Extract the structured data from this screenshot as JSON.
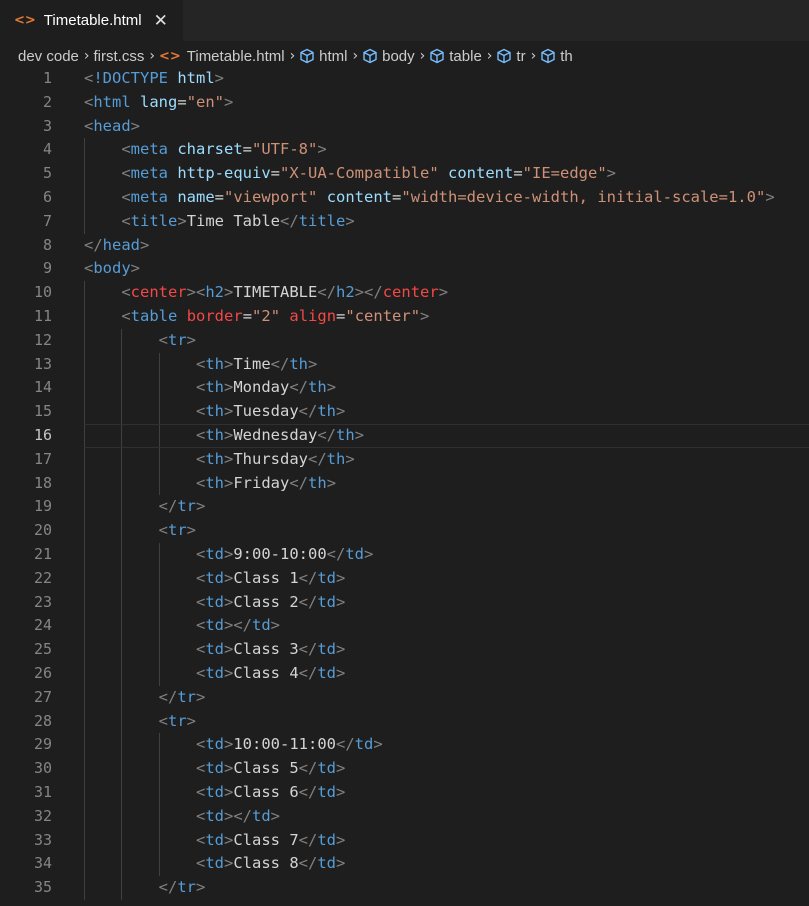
{
  "tab": {
    "label": "Timetable.html",
    "close_glyph": "✕",
    "icon": "html-file-icon"
  },
  "breadcrumb": [
    {
      "label": "dev code",
      "icon": ""
    },
    {
      "label": "first.css",
      "icon": ""
    },
    {
      "label": "Timetable.html",
      "icon": "html-file-icon"
    },
    {
      "label": "html",
      "icon": "cube-icon"
    },
    {
      "label": "body",
      "icon": "cube-icon"
    },
    {
      "label": "table",
      "icon": "cube-icon"
    },
    {
      "label": "tr",
      "icon": "cube-icon"
    },
    {
      "label": "th",
      "icon": "cube-icon"
    }
  ],
  "active_line": 16,
  "colors": {
    "tag": "#569cd6",
    "attr": "#9cdcfe",
    "string": "#ce9178",
    "text": "#d4d4d4",
    "deprecated": "#f44747",
    "punct": "#808080"
  },
  "lines": [
    [
      [
        "p",
        "<"
      ],
      [
        "t",
        "!DOCTYPE"
      ],
      [
        "x",
        " "
      ],
      [
        "a",
        "html"
      ],
      [
        "p",
        ">"
      ]
    ],
    [
      [
        "p",
        "<"
      ],
      [
        "t",
        "html"
      ],
      [
        "x",
        " "
      ],
      [
        "a",
        "lang"
      ],
      [
        "x",
        "="
      ],
      [
        "s",
        "\"en\""
      ],
      [
        "p",
        ">"
      ]
    ],
    [
      [
        "p",
        "<"
      ],
      [
        "t",
        "head"
      ],
      [
        "p",
        ">"
      ]
    ],
    [
      [
        "x",
        "    "
      ],
      [
        "p",
        "<"
      ],
      [
        "t",
        "meta"
      ],
      [
        "x",
        " "
      ],
      [
        "a",
        "charset"
      ],
      [
        "x",
        "="
      ],
      [
        "s",
        "\"UTF-8\""
      ],
      [
        "p",
        ">"
      ]
    ],
    [
      [
        "x",
        "    "
      ],
      [
        "p",
        "<"
      ],
      [
        "t",
        "meta"
      ],
      [
        "x",
        " "
      ],
      [
        "a",
        "http-equiv"
      ],
      [
        "x",
        "="
      ],
      [
        "s",
        "\"X-UA-Compatible\""
      ],
      [
        "x",
        " "
      ],
      [
        "a",
        "content"
      ],
      [
        "x",
        "="
      ],
      [
        "s",
        "\"IE=edge\""
      ],
      [
        "p",
        ">"
      ]
    ],
    [
      [
        "x",
        "    "
      ],
      [
        "p",
        "<"
      ],
      [
        "t",
        "meta"
      ],
      [
        "x",
        " "
      ],
      [
        "a",
        "name"
      ],
      [
        "x",
        "="
      ],
      [
        "s",
        "\"viewport\""
      ],
      [
        "x",
        " "
      ],
      [
        "a",
        "content"
      ],
      [
        "x",
        "="
      ],
      [
        "s",
        "\"width=device-width, initial-scale=1.0\""
      ],
      [
        "p",
        ">"
      ]
    ],
    [
      [
        "x",
        "    "
      ],
      [
        "p",
        "<"
      ],
      [
        "t",
        "title"
      ],
      [
        "p",
        ">"
      ],
      [
        "x",
        "Time Table"
      ],
      [
        "p",
        "</"
      ],
      [
        "t",
        "title"
      ],
      [
        "p",
        ">"
      ]
    ],
    [
      [
        "p",
        "</"
      ],
      [
        "t",
        "head"
      ],
      [
        "p",
        ">"
      ]
    ],
    [
      [
        "p",
        "<"
      ],
      [
        "t",
        "body"
      ],
      [
        "p",
        ">"
      ]
    ],
    [
      [
        "x",
        "    "
      ],
      [
        "p",
        "<"
      ],
      [
        "r",
        "center"
      ],
      [
        "p",
        "><"
      ],
      [
        "t",
        "h2"
      ],
      [
        "p",
        ">"
      ],
      [
        "x",
        "TIMETABLE"
      ],
      [
        "p",
        "</"
      ],
      [
        "t",
        "h2"
      ],
      [
        "p",
        "></"
      ],
      [
        "r",
        "center"
      ],
      [
        "p",
        ">"
      ]
    ],
    [
      [
        "x",
        "    "
      ],
      [
        "p",
        "<"
      ],
      [
        "t",
        "table"
      ],
      [
        "x",
        " "
      ],
      [
        "r",
        "border"
      ],
      [
        "x",
        "="
      ],
      [
        "s",
        "\"2\""
      ],
      [
        "x",
        " "
      ],
      [
        "r",
        "align"
      ],
      [
        "x",
        "="
      ],
      [
        "s",
        "\"center\""
      ],
      [
        "p",
        ">"
      ]
    ],
    [
      [
        "x",
        "        "
      ],
      [
        "p",
        "<"
      ],
      [
        "t",
        "tr"
      ],
      [
        "p",
        ">"
      ]
    ],
    [
      [
        "x",
        "            "
      ],
      [
        "p",
        "<"
      ],
      [
        "t",
        "th"
      ],
      [
        "p",
        ">"
      ],
      [
        "x",
        "Time"
      ],
      [
        "p",
        "</"
      ],
      [
        "t",
        "th"
      ],
      [
        "p",
        ">"
      ]
    ],
    [
      [
        "x",
        "            "
      ],
      [
        "p",
        "<"
      ],
      [
        "t",
        "th"
      ],
      [
        "p",
        ">"
      ],
      [
        "x",
        "Monday"
      ],
      [
        "p",
        "</"
      ],
      [
        "t",
        "th"
      ],
      [
        "p",
        ">"
      ]
    ],
    [
      [
        "x",
        "            "
      ],
      [
        "p",
        "<"
      ],
      [
        "t",
        "th"
      ],
      [
        "p",
        ">"
      ],
      [
        "x",
        "Tuesday"
      ],
      [
        "p",
        "</"
      ],
      [
        "t",
        "th"
      ],
      [
        "p",
        ">"
      ]
    ],
    [
      [
        "x",
        "            "
      ],
      [
        "p",
        "<"
      ],
      [
        "t",
        "th"
      ],
      [
        "p",
        ">"
      ],
      [
        "x",
        "Wednesday"
      ],
      [
        "p",
        "</"
      ],
      [
        "t",
        "th"
      ],
      [
        "p",
        ">"
      ]
    ],
    [
      [
        "x",
        "            "
      ],
      [
        "p",
        "<"
      ],
      [
        "t",
        "th"
      ],
      [
        "p",
        ">"
      ],
      [
        "x",
        "Thursday"
      ],
      [
        "p",
        "</"
      ],
      [
        "t",
        "th"
      ],
      [
        "p",
        ">"
      ]
    ],
    [
      [
        "x",
        "            "
      ],
      [
        "p",
        "<"
      ],
      [
        "t",
        "th"
      ],
      [
        "p",
        ">"
      ],
      [
        "x",
        "Friday"
      ],
      [
        "p",
        "</"
      ],
      [
        "t",
        "th"
      ],
      [
        "p",
        ">"
      ]
    ],
    [
      [
        "x",
        "        "
      ],
      [
        "p",
        "</"
      ],
      [
        "t",
        "tr"
      ],
      [
        "p",
        ">"
      ]
    ],
    [
      [
        "x",
        "        "
      ],
      [
        "p",
        "<"
      ],
      [
        "t",
        "tr"
      ],
      [
        "p",
        ">"
      ]
    ],
    [
      [
        "x",
        "            "
      ],
      [
        "p",
        "<"
      ],
      [
        "t",
        "td"
      ],
      [
        "p",
        ">"
      ],
      [
        "x",
        "9:00-10:00"
      ],
      [
        "p",
        "</"
      ],
      [
        "t",
        "td"
      ],
      [
        "p",
        ">"
      ]
    ],
    [
      [
        "x",
        "            "
      ],
      [
        "p",
        "<"
      ],
      [
        "t",
        "td"
      ],
      [
        "p",
        ">"
      ],
      [
        "x",
        "Class 1"
      ],
      [
        "p",
        "</"
      ],
      [
        "t",
        "td"
      ],
      [
        "p",
        ">"
      ]
    ],
    [
      [
        "x",
        "            "
      ],
      [
        "p",
        "<"
      ],
      [
        "t",
        "td"
      ],
      [
        "p",
        ">"
      ],
      [
        "x",
        "Class 2"
      ],
      [
        "p",
        "</"
      ],
      [
        "t",
        "td"
      ],
      [
        "p",
        ">"
      ]
    ],
    [
      [
        "x",
        "            "
      ],
      [
        "p",
        "<"
      ],
      [
        "t",
        "td"
      ],
      [
        "p",
        "></"
      ],
      [
        "t",
        "td"
      ],
      [
        "p",
        ">"
      ]
    ],
    [
      [
        "x",
        "            "
      ],
      [
        "p",
        "<"
      ],
      [
        "t",
        "td"
      ],
      [
        "p",
        ">"
      ],
      [
        "x",
        "Class 3"
      ],
      [
        "p",
        "</"
      ],
      [
        "t",
        "td"
      ],
      [
        "p",
        ">"
      ]
    ],
    [
      [
        "x",
        "            "
      ],
      [
        "p",
        "<"
      ],
      [
        "t",
        "td"
      ],
      [
        "p",
        ">"
      ],
      [
        "x",
        "Class 4"
      ],
      [
        "p",
        "</"
      ],
      [
        "t",
        "td"
      ],
      [
        "p",
        ">"
      ]
    ],
    [
      [
        "x",
        "        "
      ],
      [
        "p",
        "</"
      ],
      [
        "t",
        "tr"
      ],
      [
        "p",
        ">"
      ]
    ],
    [
      [
        "x",
        "        "
      ],
      [
        "p",
        "<"
      ],
      [
        "t",
        "tr"
      ],
      [
        "p",
        ">"
      ]
    ],
    [
      [
        "x",
        "            "
      ],
      [
        "p",
        "<"
      ],
      [
        "t",
        "td"
      ],
      [
        "p",
        ">"
      ],
      [
        "x",
        "10:00-11:00"
      ],
      [
        "p",
        "</"
      ],
      [
        "t",
        "td"
      ],
      [
        "p",
        ">"
      ]
    ],
    [
      [
        "x",
        "            "
      ],
      [
        "p",
        "<"
      ],
      [
        "t",
        "td"
      ],
      [
        "p",
        ">"
      ],
      [
        "x",
        "Class 5"
      ],
      [
        "p",
        "</"
      ],
      [
        "t",
        "td"
      ],
      [
        "p",
        ">"
      ]
    ],
    [
      [
        "x",
        "            "
      ],
      [
        "p",
        "<"
      ],
      [
        "t",
        "td"
      ],
      [
        "p",
        ">"
      ],
      [
        "x",
        "Class 6"
      ],
      [
        "p",
        "</"
      ],
      [
        "t",
        "td"
      ],
      [
        "p",
        ">"
      ]
    ],
    [
      [
        "x",
        "            "
      ],
      [
        "p",
        "<"
      ],
      [
        "t",
        "td"
      ],
      [
        "p",
        "></"
      ],
      [
        "t",
        "td"
      ],
      [
        "p",
        ">"
      ]
    ],
    [
      [
        "x",
        "            "
      ],
      [
        "p",
        "<"
      ],
      [
        "t",
        "td"
      ],
      [
        "p",
        ">"
      ],
      [
        "x",
        "Class 7"
      ],
      [
        "p",
        "</"
      ],
      [
        "t",
        "td"
      ],
      [
        "p",
        ">"
      ]
    ],
    [
      [
        "x",
        "            "
      ],
      [
        "p",
        "<"
      ],
      [
        "t",
        "td"
      ],
      [
        "p",
        ">"
      ],
      [
        "x",
        "Class 8"
      ],
      [
        "p",
        "</"
      ],
      [
        "t",
        "td"
      ],
      [
        "p",
        ">"
      ]
    ],
    [
      [
        "x",
        "        "
      ],
      [
        "p",
        "</"
      ],
      [
        "t",
        "tr"
      ],
      [
        "p",
        ">"
      ]
    ]
  ]
}
